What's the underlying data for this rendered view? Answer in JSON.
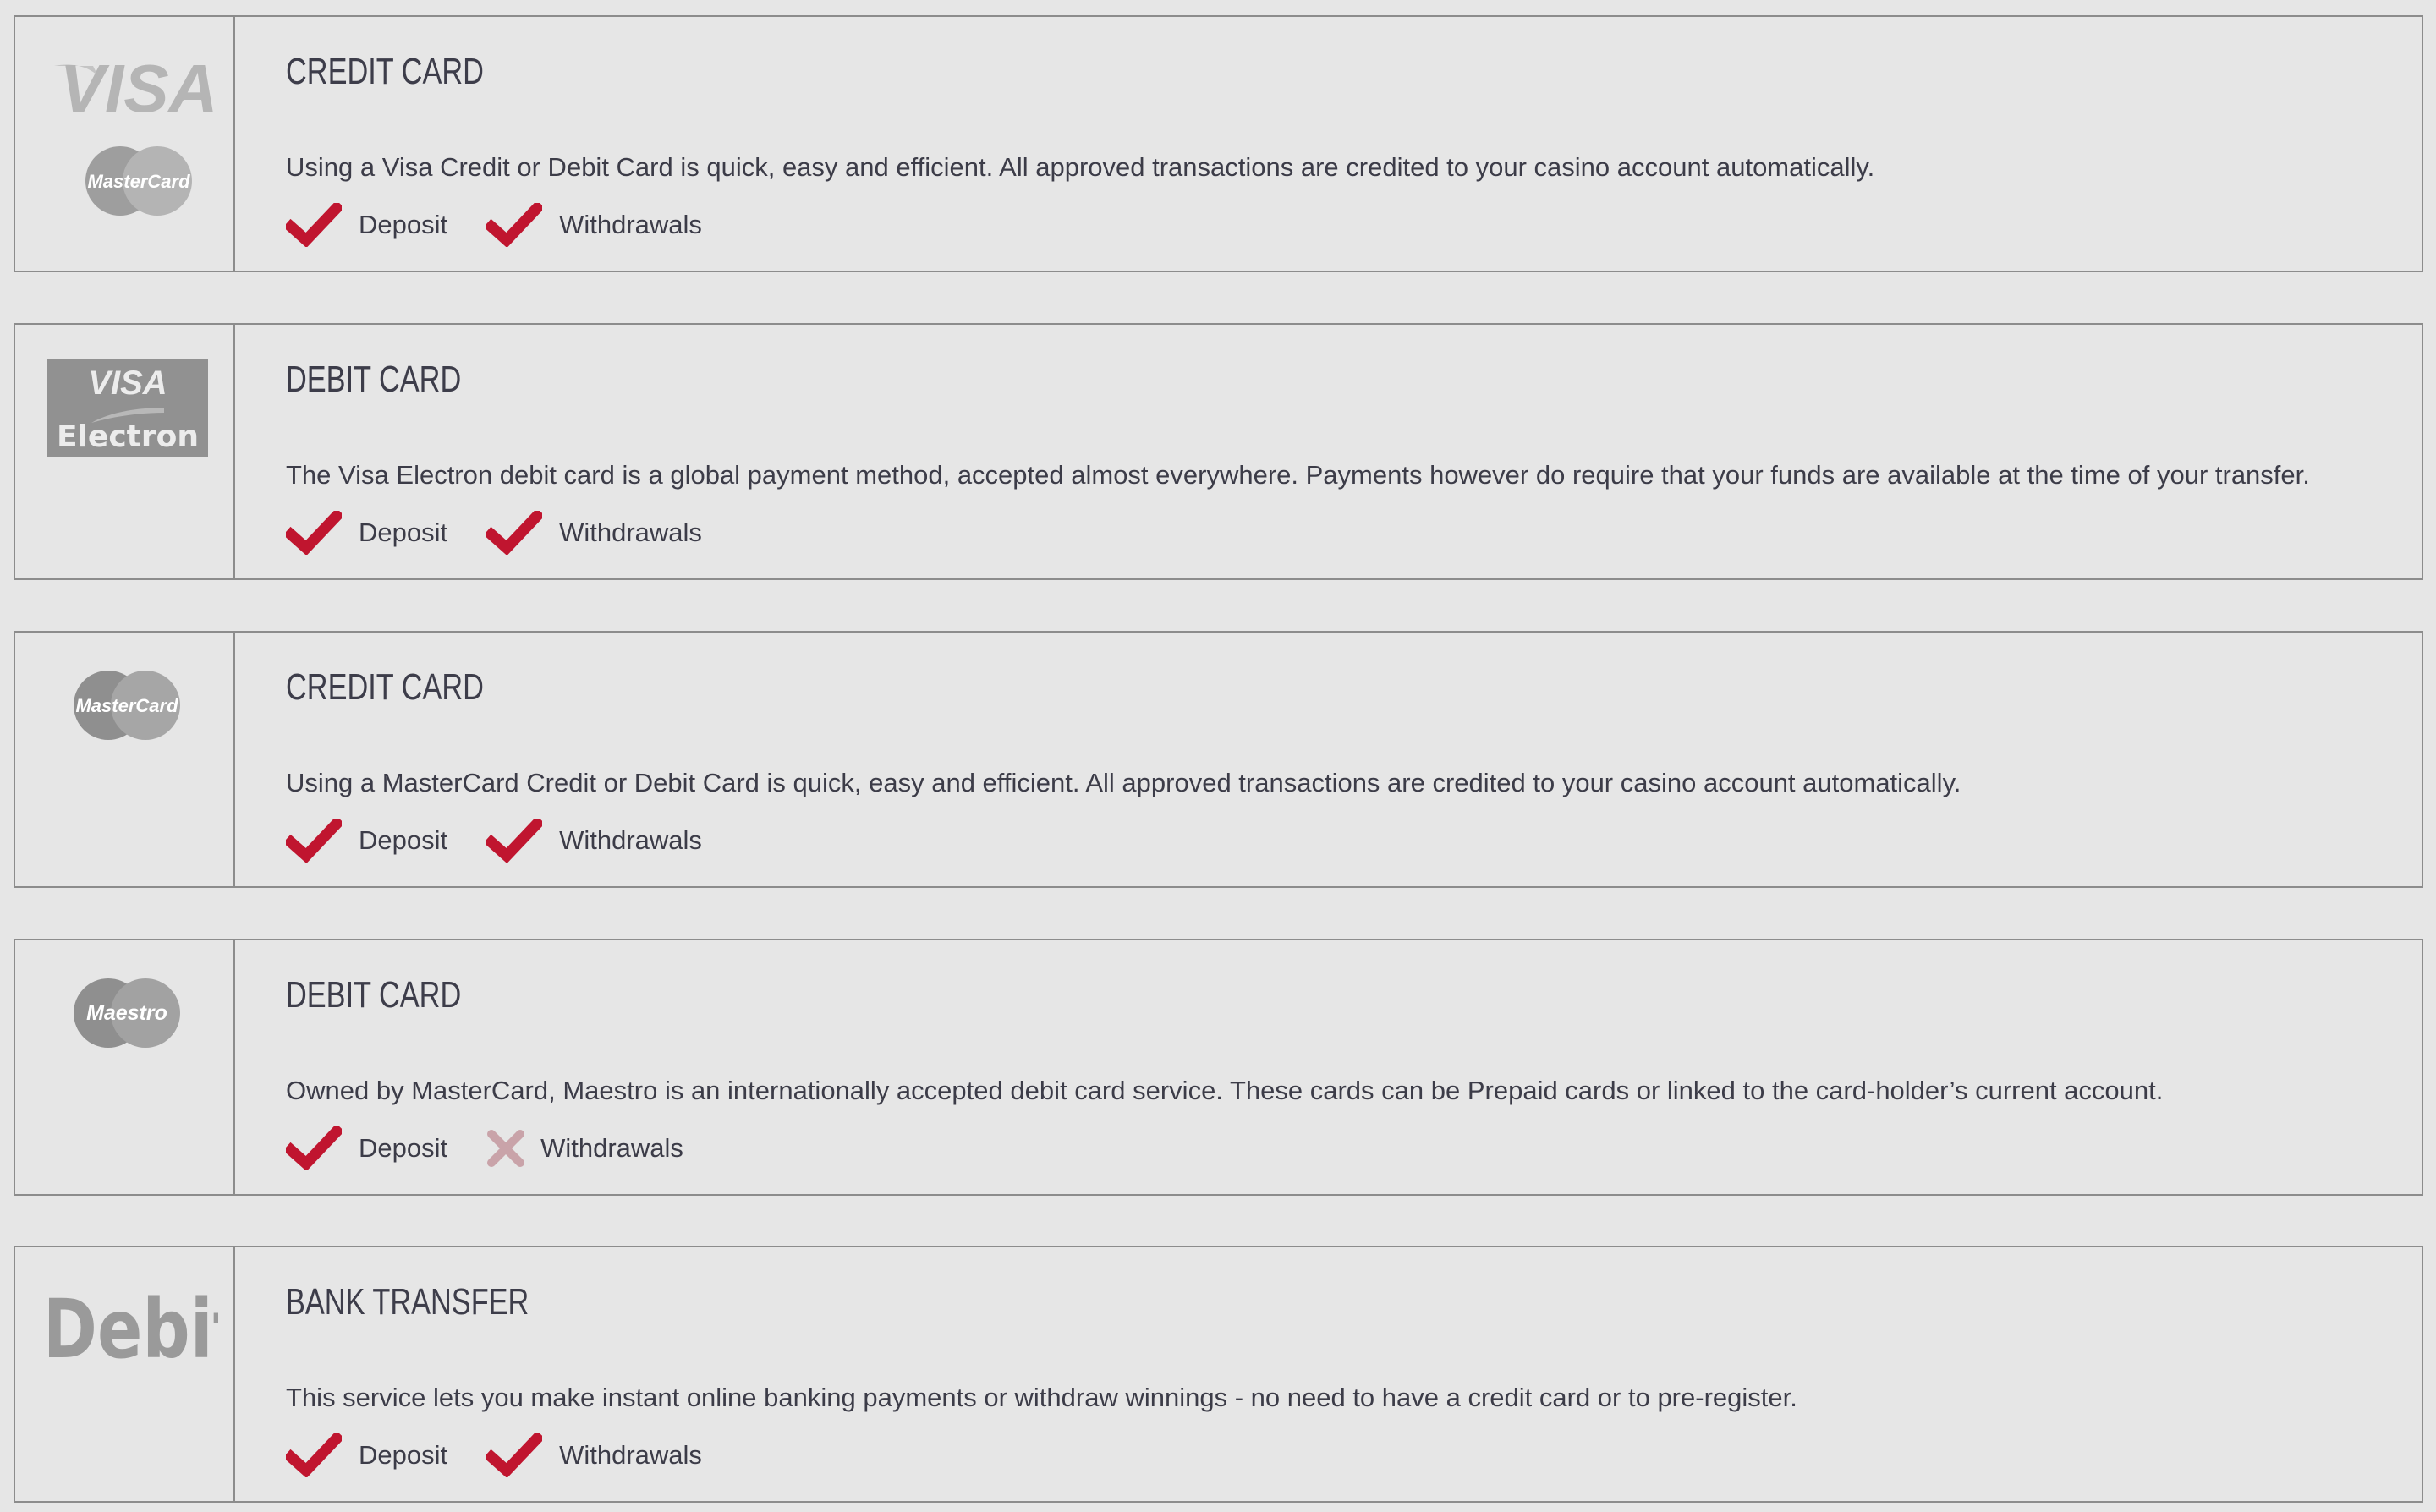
{
  "colors": {
    "accent": "#c0152f",
    "disabled": "#c9a3a9",
    "text": "#3c3c48",
    "border": "#8c8c8c",
    "background": "#e6e6e6",
    "logo_gray": "#9a9a9a"
  },
  "methods": [
    {
      "logo": [
        "visa-logo",
        "mastercard-logo"
      ],
      "logo_text": {
        "visa": "VISA",
        "mastercard": "MasterCard"
      },
      "title": "CREDIT CARD",
      "description": "Using a Visa Credit or Debit Card is quick, easy and efficient. All approved transactions are credited to your casino account automatically.",
      "features": [
        {
          "label": "Deposit",
          "supported": true,
          "icon": "check-icon"
        },
        {
          "label": "Withdrawals",
          "supported": true,
          "icon": "check-icon"
        }
      ]
    },
    {
      "logo": [
        "visa-electron-logo"
      ],
      "logo_text": {
        "visa": "VISA",
        "electron": "Electron"
      },
      "title": "DEBIT CARD",
      "description": "The Visa Electron debit card is a global payment method, accepted almost everywhere. Payments however do require that your funds are available at the time of your transfer.",
      "features": [
        {
          "label": "Deposit",
          "supported": true,
          "icon": "check-icon"
        },
        {
          "label": "Withdrawals",
          "supported": true,
          "icon": "check-icon"
        }
      ]
    },
    {
      "logo": [
        "mastercard-logo"
      ],
      "logo_text": {
        "mastercard": "MasterCard"
      },
      "title": "CREDIT CARD",
      "description": "Using a MasterCard Credit or Debit Card is quick, easy and efficient. All approved transactions are credited to your casino account automatically.",
      "features": [
        {
          "label": "Deposit",
          "supported": true,
          "icon": "check-icon"
        },
        {
          "label": "Withdrawals",
          "supported": true,
          "icon": "check-icon"
        }
      ]
    },
    {
      "logo": [
        "maestro-logo"
      ],
      "logo_text": {
        "maestro": "Maestro"
      },
      "title": "DEBIT CARD",
      "description": "Owned by MasterCard, Maestro is an internationally accepted debit card service. These cards can be Prepaid cards or linked to the card-holder’s current account.",
      "features": [
        {
          "label": "Deposit",
          "supported": true,
          "icon": "check-icon"
        },
        {
          "label": "Withdrawals",
          "supported": false,
          "icon": "cross-icon"
        }
      ]
    },
    {
      "logo": [
        "idebit-logo"
      ],
      "logo_text": {
        "idebit": "iDebit"
      },
      "title": "BANK TRANSFER",
      "description": "This service lets you make instant online banking payments or withdraw winnings - no need to have a credit card or to pre-register.",
      "features": [
        {
          "label": "Deposit",
          "supported": true,
          "icon": "check-icon"
        },
        {
          "label": "Withdrawals",
          "supported": true,
          "icon": "check-icon"
        }
      ]
    }
  ]
}
